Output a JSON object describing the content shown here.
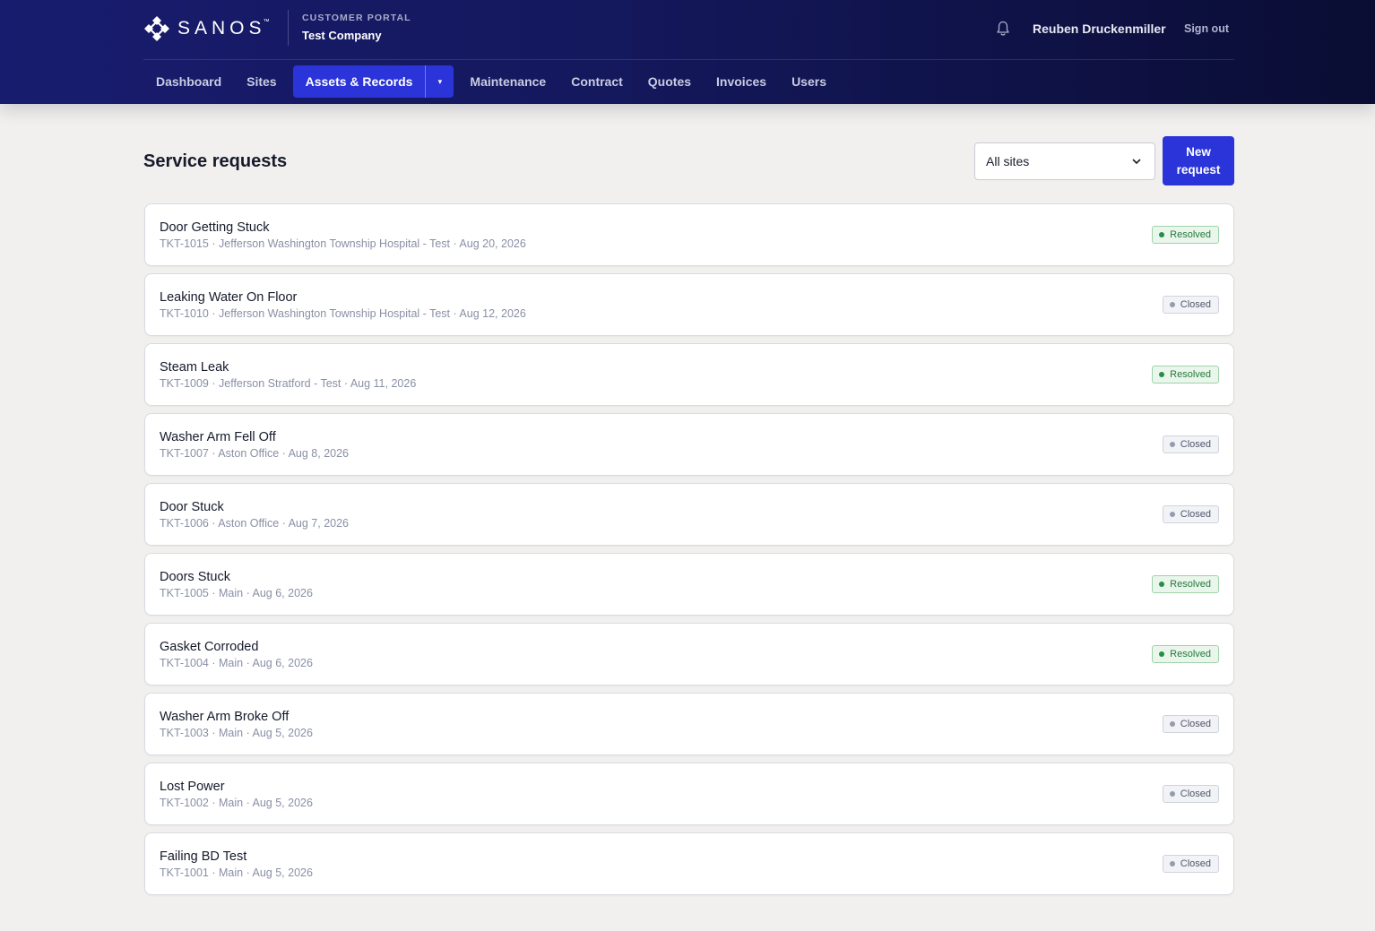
{
  "header": {
    "brand": "SANOS",
    "brand_tm": "™",
    "portal_label": "CUSTOMER PORTAL",
    "company": "Test Company",
    "user_name": "Reuben Druckenmiller",
    "sign_out": "Sign out",
    "icons": {
      "logo": "sanos-logo-icon",
      "notifications": "bell-icon"
    }
  },
  "nav": {
    "items": [
      "Dashboard",
      "Sites",
      "Assets & Records",
      "Maintenance",
      "Contract",
      "Quotes",
      "Invoices",
      "Users"
    ],
    "active": "Assets & Records",
    "active_caret": "▾"
  },
  "page": {
    "title": "Service requests",
    "site_filter": "All sites",
    "new_request_line1": "New",
    "new_request_line2": "request"
  },
  "requests": [
    {
      "title": "Door Getting Stuck",
      "meta": "TKT-1015 · Jefferson Washington Township Hospital - Test · Aug 20, 2026",
      "status": "Resolved"
    },
    {
      "title": "Leaking Water On Floor",
      "meta": "TKT-1010 · Jefferson Washington Township Hospital - Test · Aug 12, 2026",
      "status": "Closed"
    },
    {
      "title": "Steam Leak",
      "meta": "TKT-1009 · Jefferson Stratford - Test · Aug 11, 2026",
      "status": "Resolved"
    },
    {
      "title": "Washer Arm Fell Off",
      "meta": "TKT-1007 · Aston Office · Aug 8, 2026",
      "status": "Closed"
    },
    {
      "title": "Door Stuck",
      "meta": "TKT-1006 · Aston Office · Aug 7, 2026",
      "status": "Closed"
    },
    {
      "title": "Doors Stuck",
      "meta": "TKT-1005 · Main · Aug 6, 2026",
      "status": "Resolved"
    },
    {
      "title": "Gasket Corroded",
      "meta": "TKT-1004 · Main · Aug 6, 2026",
      "status": "Resolved"
    },
    {
      "title": "Washer Arm Broke Off",
      "meta": "TKT-1003 · Main · Aug 5, 2026",
      "status": "Closed"
    },
    {
      "title": "Lost Power",
      "meta": "TKT-1002 · Main · Aug 5, 2026",
      "status": "Closed"
    },
    {
      "title": "Failing BD Test",
      "meta": "TKT-1001 · Main · Aug 5, 2026",
      "status": "Closed"
    }
  ],
  "colors": {
    "accent": "#2a34d9",
    "header_start": "#181c6e",
    "header_end": "#0a0d33",
    "resolved": "#227a3a",
    "closed": "#4f566b"
  }
}
